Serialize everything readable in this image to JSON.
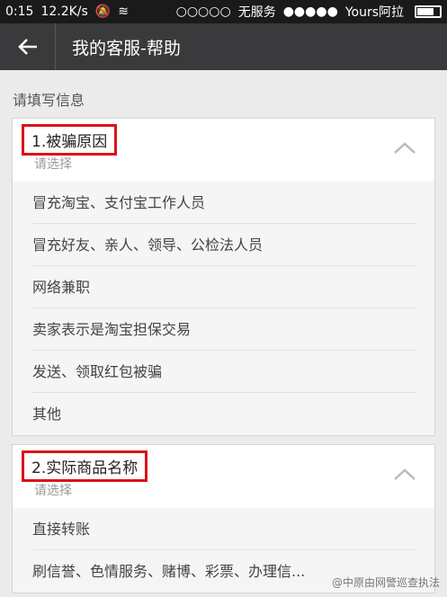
{
  "status_bar": {
    "time": "0:15",
    "speed": "12.2K/s",
    "signal_1": "○○○○○",
    "carrier_1": "无服务",
    "signal_2": "●●●●●",
    "carrier_2": "Yours阿拉"
  },
  "header": {
    "back_icon": "arrow-left-icon",
    "title": "我的客服-帮助"
  },
  "section_label": "请填写信息",
  "cards": [
    {
      "title": "1.被骗原因",
      "placeholder": "请选择",
      "options": [
        "冒充淘宝、支付宝工作人员",
        "冒充好友、亲人、领导、公检法人员",
        "网络兼职",
        "卖家表示是淘宝担保交易",
        "发送、领取红包被骗",
        "其他"
      ]
    },
    {
      "title": "2.实际商品名称",
      "placeholder": "请选择",
      "options": [
        "直接转账",
        "刷信誉、色情服务、赌博、彩票、办理信..."
      ]
    }
  ],
  "watermark": "@中原由网警巡查执法",
  "colors": {
    "header_bg": "#3a3a3c",
    "highlight_border": "#d9141a"
  }
}
